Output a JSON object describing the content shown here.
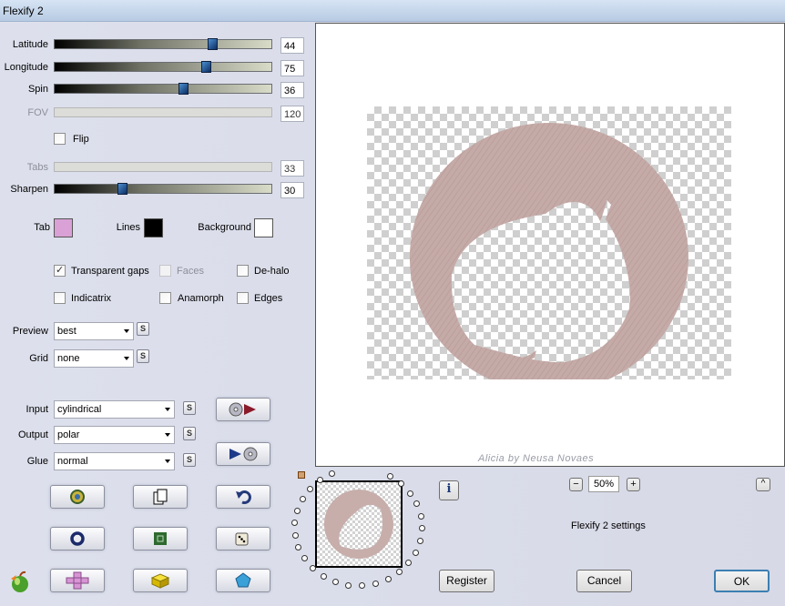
{
  "window": {
    "title": "Flexify 2"
  },
  "sliders": [
    {
      "label": "Latitude",
      "value": "44",
      "fill": 0.73,
      "enabled": true
    },
    {
      "label": "Longitude",
      "value": "75",
      "fill": 0.7,
      "enabled": true
    },
    {
      "label": "Spin",
      "value": "36",
      "fill": 0.59,
      "enabled": true
    },
    {
      "label": "FOV",
      "value": "120",
      "enabled": false
    },
    {
      "label": "Tabs",
      "value": "33",
      "enabled": false
    },
    {
      "label": "Sharpen",
      "value": "30",
      "fill": 0.31,
      "enabled": true
    }
  ],
  "flip": {
    "label": "Flip",
    "checked": false
  },
  "colors": {
    "tab": {
      "label": "Tab",
      "color": "#d9a1d5"
    },
    "lines": {
      "label": "Lines",
      "color": "#000000"
    },
    "background": {
      "label": "Background",
      "color": "#ffffff"
    }
  },
  "options": {
    "transparent_gaps": {
      "label": "Transparent gaps",
      "checked": true
    },
    "faces": {
      "label": "Faces",
      "checked": false,
      "enabled": false
    },
    "de_halo": {
      "label": "De-halo",
      "checked": false
    },
    "indicatrix": {
      "label": "Indicatrix",
      "checked": false
    },
    "anamorph": {
      "label": "Anamorph",
      "checked": false
    },
    "edges": {
      "label": "Edges",
      "checked": false
    }
  },
  "selects": {
    "preview": {
      "label": "Preview",
      "value": "best"
    },
    "grid": {
      "label": "Grid",
      "value": "none"
    },
    "input": {
      "label": "Input",
      "value": "cylindrical"
    },
    "output": {
      "label": "Output",
      "value": "polar"
    },
    "glue": {
      "label": "Glue",
      "value": "normal"
    },
    "s_label": "S"
  },
  "zoom": {
    "minus": "−",
    "value": "50%",
    "plus": "+"
  },
  "info_text": "i",
  "settings_text": "Flexify 2 settings",
  "collapse_label": "^",
  "watermark": "Alicia by Neusa Novaes",
  "buttons": {
    "register": "Register",
    "cancel": "Cancel",
    "ok": "OK"
  },
  "accent_colors": {
    "shape": "#c7aeab",
    "slider_thumb": "#1d4f8c"
  }
}
